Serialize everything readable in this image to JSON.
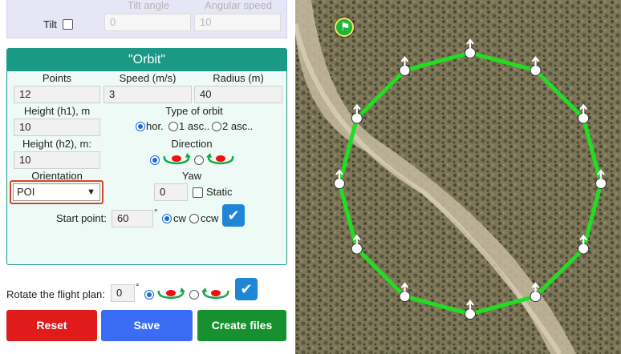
{
  "tilt": {
    "label": "Tilt",
    "angle_label": "Tilt angle",
    "angle_value": "0",
    "speed_label": "Angular speed",
    "speed_value": "10"
  },
  "orbit": {
    "title": "\"Orbit\"",
    "points_label": "Points",
    "points_value": "12",
    "speed_label": "Speed (m/s)",
    "speed_value": "3",
    "radius_label": "Radius (m)",
    "radius_value": "40",
    "h1_label": "Height (h1), m",
    "h1_value": "10",
    "type_label": "Type of orbit",
    "type_options": [
      "hor.",
      "1 asc..",
      "2 asc.."
    ],
    "h2_label": "Height (h2), m:",
    "h2_value": "10",
    "direction_label": "Direction",
    "orientation_label": "Orientation",
    "orientation_value": "POI",
    "yaw_label": "Yaw",
    "yaw_value": "0",
    "static_label": "Static",
    "start_label": "Start point:",
    "start_value": "60",
    "degree": "°",
    "cw_label": "cw",
    "ccw_label": "ccw",
    "confirm_icon": "checkmark-icon"
  },
  "rotate": {
    "label": "Rotate the flight plan:",
    "value": "0",
    "degree": "°"
  },
  "buttons": {
    "reset": "Reset",
    "save": "Save",
    "create": "Create files"
  },
  "colors": {
    "reset": "#e01b1b",
    "save": "#3b6cf6",
    "create": "#17912f",
    "orbit_header": "#1a9a86",
    "flight_path": "#22dd22"
  },
  "map": {
    "home_icon": "flag-icon",
    "waypoint_count": 12
  }
}
